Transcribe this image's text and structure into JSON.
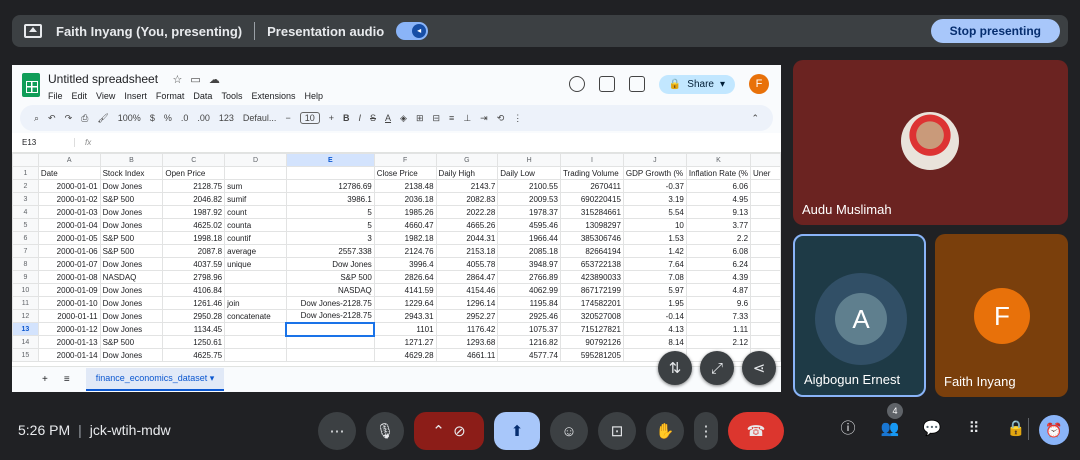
{
  "banner": {
    "presenter": "Faith Inyang (You, presenting)",
    "audio_label": "Presentation audio",
    "stop_label": "Stop presenting"
  },
  "sheet": {
    "title": "Untitled spreadsheet",
    "menus": [
      "File",
      "Edit",
      "View",
      "Insert",
      "Format",
      "Data",
      "Tools",
      "Extensions",
      "Help"
    ],
    "share_label": "Share",
    "account_initial": "F",
    "toolbar": {
      "zoom": "100%",
      "currency": "$",
      "percent": "%",
      "dec_less": ".0",
      "dec_more": ".00",
      "number_format": "123",
      "font": "Defaul...",
      "minus": "−",
      "font_size": "10",
      "plus": "+",
      "bold": "B",
      "italic": "I",
      "text_color": "A"
    },
    "cell_ref": "E13",
    "fx": "fx",
    "col_headers": [
      "A",
      "B",
      "C",
      "D",
      "E",
      "F",
      "G",
      "H",
      "I",
      "J",
      "K",
      ""
    ],
    "rows": [
      [
        "1",
        "Date",
        "Stock Index",
        "Open Price",
        "",
        "",
        "Close Price",
        "Daily High",
        "Daily Low",
        "Trading Volume",
        "GDP Growth (%",
        "Inflation Rate (%",
        "Uner"
      ],
      [
        "2",
        "2000-01-01",
        "Dow Jones",
        "2128.75",
        "sum",
        "12786.69",
        "2138.48",
        "2143.7",
        "2100.55",
        "2670411",
        "-0.37",
        "6.06",
        ""
      ],
      [
        "3",
        "2000-01-02",
        "S&P 500",
        "2046.82",
        "sumif",
        "3986.1",
        "2036.18",
        "2082.83",
        "2009.53",
        "690220415",
        "3.19",
        "4.95",
        ""
      ],
      [
        "4",
        "2000-01-03",
        "Dow Jones",
        "1987.92",
        "count",
        "5",
        "1985.26",
        "2022.28",
        "1978.37",
        "315284661",
        "5.54",
        "9.13",
        ""
      ],
      [
        "5",
        "2000-01-04",
        "Dow Jones",
        "4625.02",
        "counta",
        "5",
        "4660.47",
        "4665.26",
        "4595.46",
        "13098297",
        "10",
        "3.77",
        ""
      ],
      [
        "6",
        "2000-01-05",
        "S&P 500",
        "1998.18",
        "countif",
        "3",
        "1982.18",
        "2044.31",
        "1966.44",
        "385306746",
        "1.53",
        "2.2",
        ""
      ],
      [
        "7",
        "2000-01-06",
        "S&P 500",
        "2087.8",
        "average",
        "2557.338",
        "2124.76",
        "2153.18",
        "2085.18",
        "82664194",
        "1.42",
        "6.08",
        ""
      ],
      [
        "8",
        "2000-01-07",
        "Dow Jones",
        "4037.59",
        "unique",
        "Dow Jones",
        "3996.4",
        "4055.78",
        "3948.97",
        "653722138",
        "7.64",
        "6.24",
        ""
      ],
      [
        "9",
        "2000-01-08",
        "NASDAQ",
        "2798.96",
        "",
        "S&P 500",
        "2826.64",
        "2864.47",
        "2766.89",
        "423890033",
        "7.08",
        "4.39",
        ""
      ],
      [
        "10",
        "2000-01-09",
        "Dow Jones",
        "4106.84",
        "",
        "NASDAQ",
        "4141.59",
        "4154.46",
        "4062.99",
        "867172199",
        "5.97",
        "4.87",
        ""
      ],
      [
        "11",
        "2000-01-10",
        "Dow Jones",
        "1261.46",
        "join",
        "Dow Jones-2128.75",
        "1229.64",
        "1296.14",
        "1195.84",
        "174582201",
        "1.95",
        "9.6",
        ""
      ],
      [
        "12",
        "2000-01-11",
        "Dow Jones",
        "2950.28",
        "concatenate",
        "Dow Jones-2128.75",
        "2943.31",
        "2952.27",
        "2925.46",
        "320527008",
        "-0.14",
        "7.33",
        ""
      ],
      [
        "13",
        "2000-01-12",
        "Dow Jones",
        "1134.45",
        "",
        "",
        "1101",
        "1176.42",
        "1075.37",
        "715127821",
        "4.13",
        "1.11",
        ""
      ],
      [
        "14",
        "2000-01-13",
        "S&P 500",
        "1250.61",
        "",
        "",
        "1271.27",
        "1293.68",
        "1216.82",
        "90792126",
        "8.14",
        "2.12",
        ""
      ],
      [
        "15",
        "2000-01-14",
        "Dow Jones",
        "4625.75",
        "",
        "",
        "4629.28",
        "4661.11",
        "4577.74",
        "595281205",
        "",
        "",
        ""
      ]
    ],
    "sheet_tab": "finance_economics_dataset"
  },
  "participants": [
    {
      "name": "Audu Muslimah"
    },
    {
      "name": "Aigbogun Ernest",
      "initial": "A"
    },
    {
      "name": "Faith Inyang",
      "initial": "F"
    }
  ],
  "bottom": {
    "time": "5:26 PM",
    "meeting_code": "jck-wtih-mdw",
    "people_count": "4"
  },
  "colors": {
    "background": "#202124",
    "accent": "#8ab4f8",
    "end_call": "#dc362e",
    "sheets_green": "#0f9d58"
  }
}
